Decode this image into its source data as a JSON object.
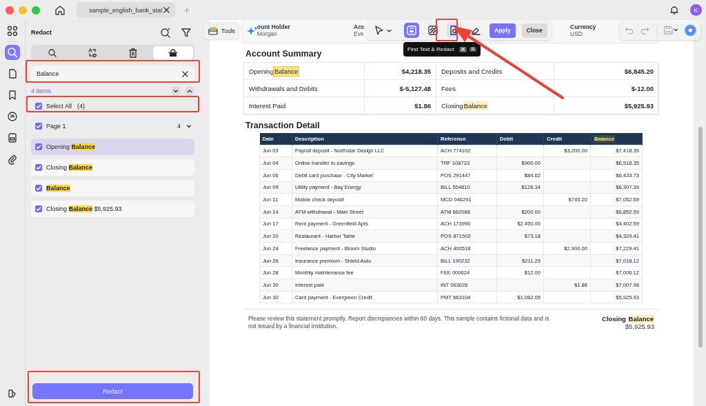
{
  "window": {
    "tab_title": "sample_english_bank_stat",
    "avatar": "K"
  },
  "sidebar": {
    "title": "Redact",
    "tabs": [
      {
        "kind": "search",
        "selected": false
      },
      {
        "kind": "replace",
        "selected": false
      },
      {
        "kind": "delete",
        "selected": false
      },
      {
        "kind": "redact",
        "selected": true
      }
    ],
    "search": {
      "value": "Balance"
    },
    "count": "4 items",
    "select_all": {
      "label": "Select All",
      "count": "(4)",
      "checked": true
    },
    "page_group": {
      "label": "Page 1",
      "count": "4",
      "checked": true,
      "expanded": true
    },
    "results": [
      {
        "before": "Opening ",
        "match": "Balance",
        "checked": true,
        "selected": true
      },
      {
        "before": "Closing ",
        "match": "Balance",
        "checked": true,
        "selected": false
      },
      {
        "match": "Balance",
        "checked": true,
        "selected": false
      },
      {
        "before": "Closing ",
        "match": "Balance",
        "after": " $5,925.93",
        "checked": true,
        "selected": false
      }
    ],
    "redact_button": "Redact"
  },
  "toolbar": {
    "tools_label": "Tools",
    "tools": [
      {
        "kind": "pointer",
        "selected": false
      },
      {
        "kind": "mark",
        "selected": true
      },
      {
        "kind": "pattern",
        "selected": false
      },
      {
        "kind": "find",
        "selected": true
      },
      {
        "kind": "eraser",
        "selected": false
      }
    ],
    "apply": "Apply",
    "close": "Close",
    "tooltip": {
      "text": "Find Text & Redact",
      "keys": [
        "⌘",
        "R"
      ]
    }
  },
  "document": {
    "header": [
      {
        "label": "ount Holder",
        "value": "Morgan"
      },
      {
        "label": "Acc",
        "value": "Eve"
      },
      {
        "label": "Currency",
        "value": "USD"
      }
    ],
    "summary_title": "Account Summary",
    "summary": [
      {
        "label": "Opening ",
        "match": "Balance",
        "current": true,
        "amount": "$4,218.35"
      },
      {
        "label": "Deposits and Credits",
        "amount": "$6,845.20"
      },
      {
        "label": "Withdrawals and Debits",
        "amount": "$-5,127.48"
      },
      {
        "label": "Fees",
        "amount": "$-12.00"
      },
      {
        "label": "Interest Paid",
        "amount": "$1.86"
      },
      {
        "label": "Closing ",
        "match": "Balance",
        "current": false,
        "amount": "$5,925.93"
      }
    ],
    "transactions_title": "Transaction Detail",
    "transactions": {
      "columns": [
        {
          "label": "Date",
          "highlighted": false
        },
        {
          "label": "Description",
          "highlighted": false
        },
        {
          "label": "Reference",
          "highlighted": false
        },
        {
          "label": "Debit",
          "highlighted": false
        },
        {
          "label": "Credit",
          "highlighted": false
        },
        {
          "label": "Balance",
          "highlighted": true
        }
      ],
      "rows": [
        [
          "Jun 03",
          "Payroll deposit - Northstar Design LLC",
          "ACH 774102",
          null,
          "$3,200.00",
          "$7,418.35"
        ],
        [
          "Jun 04",
          "Online transfer to savings",
          "TRF 108733",
          "$900.00",
          null,
          "$6,518.35"
        ],
        [
          "Jun 06",
          "Debit card purchase - City Market",
          "POS 291447",
          "$84.62",
          null,
          "$6,433.73"
        ],
        [
          "Jun 09",
          "Utility payment - Bay Energy",
          "BILL 554810",
          "$126.34",
          null,
          "$6,307.39"
        ],
        [
          "Jun 11",
          "Mobile check deposit",
          "MCD 046291",
          null,
          "$745.20",
          "$7,052.59"
        ],
        [
          "Jun 14",
          "ATM withdrawal - Main Street",
          "ATM 662088",
          "$200.00",
          null,
          "$6,852.59"
        ],
        [
          "Jun 17",
          "Rent payment - Greenfield Apts",
          "ACH 173990",
          "$2,450.00",
          null,
          "$4,402.59"
        ],
        [
          "Jun 20",
          "Restaurant - Harbor Table",
          "POS 871502",
          "$73.18",
          null,
          "$4,329.41"
        ],
        [
          "Jun 24",
          "Freelance payment - Bloom Studio",
          "ACH 400518",
          null,
          "$2,900.00",
          "$7,229.41"
        ],
        [
          "Jun 26",
          "Insurance premium - Shield Auto",
          "BILL 190232",
          "$211.29",
          null,
          "$7,018.12"
        ],
        [
          "Jun 28",
          "Monthly maintenance fee",
          "FEE 000624",
          "$12.00",
          null,
          "$7,006.12"
        ],
        [
          "Jun 30",
          "Interest paid",
          "INT 063026",
          null,
          "$1.86",
          "$7,007.98"
        ],
        [
          "Jun 30",
          "Card payment - Evergreen Credit",
          "PMT 663104",
          "$1,082.05",
          null,
          "$5,925.93"
        ]
      ]
    },
    "footer": {
      "note": "Please review this statement promptly. Report discrepancies within 60 days. This sample contains fictional data and is not issued by a financial institution.",
      "closing_label": "Closing ",
      "closing_match": "Balance",
      "current": false,
      "closing_amount": "$5,925.93"
    }
  }
}
